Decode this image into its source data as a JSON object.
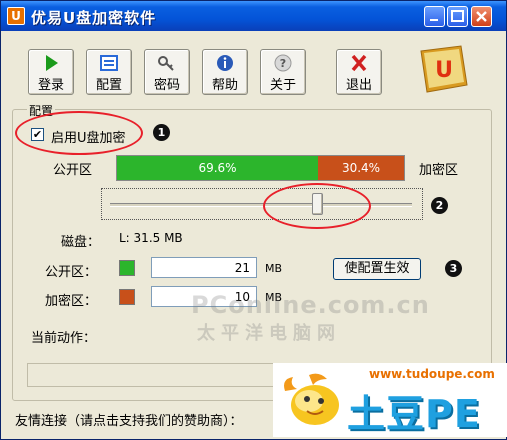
{
  "window": {
    "title": "优易U盘加密软件",
    "app_icon_letter": "U"
  },
  "toolbar": {
    "buttons": [
      {
        "label": "登录",
        "icon": "play-icon",
        "color": "#1a9a1a"
      },
      {
        "label": "配置",
        "icon": "config-icon",
        "color": "#2a6ad8"
      },
      {
        "label": "密码",
        "icon": "key-icon",
        "color": "#666666"
      },
      {
        "label": "帮助",
        "icon": "info-icon",
        "color": "#2a5ab8"
      },
      {
        "label": "关于",
        "icon": "question-icon",
        "color": "#b0b0b0"
      },
      {
        "label": "退出",
        "icon": "close-x-icon",
        "color": "#d02020"
      }
    ],
    "logo_letter": "U"
  },
  "config": {
    "group_title": "配置",
    "enable_label": "启用U盘加密",
    "enable_checked": true,
    "public_label": "公开区",
    "encrypted_label": "加密区",
    "ratio_public": "69.6%",
    "ratio_encrypted": "30.4%",
    "ratio_public_fraction": 0.696,
    "slider_fraction": 0.696,
    "disk_label": "磁盘：",
    "disk_value": "L: 31.5 MB",
    "public_size_label": "公开区：",
    "public_size_value": "21",
    "encrypted_size_label": "加密区：",
    "encrypted_size_value": "10",
    "unit": "MB",
    "apply_button": "使配置生效",
    "current_action_label": "当前动作：",
    "public_color": "#2cb52c",
    "encrypted_color": "#c8501a"
  },
  "footer": {
    "sponsor_label": "友情连接（请点击支持我们的赞助商）："
  },
  "annotations": {
    "marker_1": "1",
    "marker_2": "2",
    "marker_3": "3"
  },
  "watermarks": {
    "pconline": "PConline.com.cn",
    "pconline_cn": "太平洋电脑网",
    "tudou_url": "www.tudoupe.com",
    "tudou_brand": "土豆PE"
  }
}
